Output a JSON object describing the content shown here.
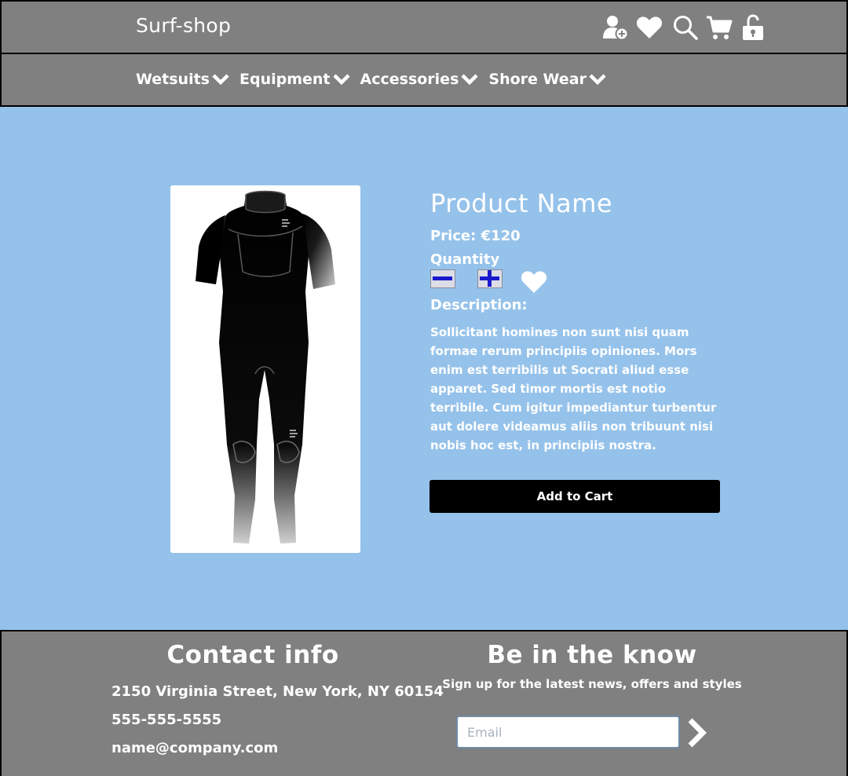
{
  "header": {
    "brand": "Surf-shop",
    "icons": [
      "add-user-icon",
      "heart-icon",
      "search-icon",
      "cart-icon",
      "unlock-icon"
    ]
  },
  "nav": {
    "items": [
      {
        "label": "Wetsuits"
      },
      {
        "label": "Equipment"
      },
      {
        "label": "Accessories"
      },
      {
        "label": "Shore Wear"
      }
    ]
  },
  "product": {
    "name": "Product Name",
    "price": "Price: €120",
    "quantity_label": "Quantity",
    "description_label": "Description:",
    "description": "Sollicitant homines non sunt nisi quam formae rerum principiis opiniones. Mors enim est terribilis ut Socrati aliud esse apparet. Sed timor mortis est notio terribile. Cum igitur impediantur turbentur aut dolere videamus aliis non tribuunt nisi nobis hoc est, in principiis nostra.",
    "add_to_cart": "Add to Cart"
  },
  "footer": {
    "contact_title": "Contact info",
    "address": "2150 Virginia Street, New York, NY 60154",
    "phone": "555-555-5555",
    "email": "name@company.com",
    "newsletter_title": "Be in the know",
    "newsletter_sub": "Sign up for the latest news, offers and styles",
    "email_placeholder": "Email"
  },
  "colors": {
    "header_bg": "#808080",
    "main_bg": "#95c2ea",
    "button_bg": "#000000",
    "qty_icon": "#1a1acc"
  }
}
